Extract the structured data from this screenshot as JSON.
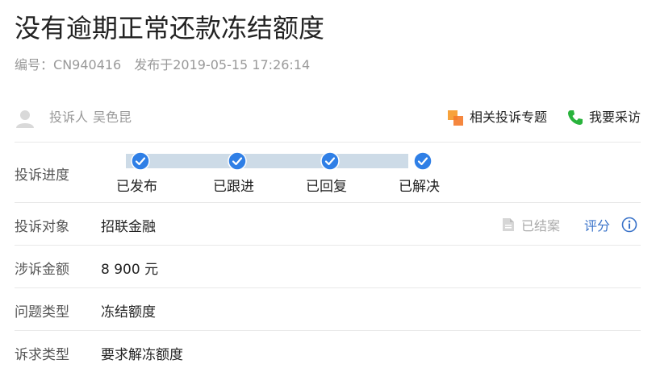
{
  "page": {
    "title": "没有逾期正常还款冻结额度",
    "serial_label": "编号：",
    "serial_value": "CN940416",
    "published_label": "发布于",
    "published_value": "2019-05-15 17:26:14"
  },
  "author": {
    "label": "投诉人",
    "name": "吴色昆"
  },
  "actions": {
    "topic_label": "相关投诉专题",
    "interview_label": "我要采访"
  },
  "progress": {
    "label": "投诉进度",
    "steps": [
      {
        "label": "已发布"
      },
      {
        "label": "已跟进"
      },
      {
        "label": "已回复"
      },
      {
        "label": "已解决"
      }
    ]
  },
  "target": {
    "label": "投诉对象",
    "value": "招联金融",
    "status": "已结案",
    "rate_label": "评分"
  },
  "amount": {
    "label": "涉诉金额",
    "value": "8 900 元"
  },
  "issue_type": {
    "label": "问题类型",
    "value": "冻结额度"
  },
  "demand_type": {
    "label": "诉求类型",
    "value": "要求解冻额度"
  },
  "colors": {
    "link": "#3a73c9",
    "step_done": "#2f7fe6",
    "track": "#cddbe7",
    "phone": "#29b33c",
    "topic_orange": "#f7a23b"
  }
}
